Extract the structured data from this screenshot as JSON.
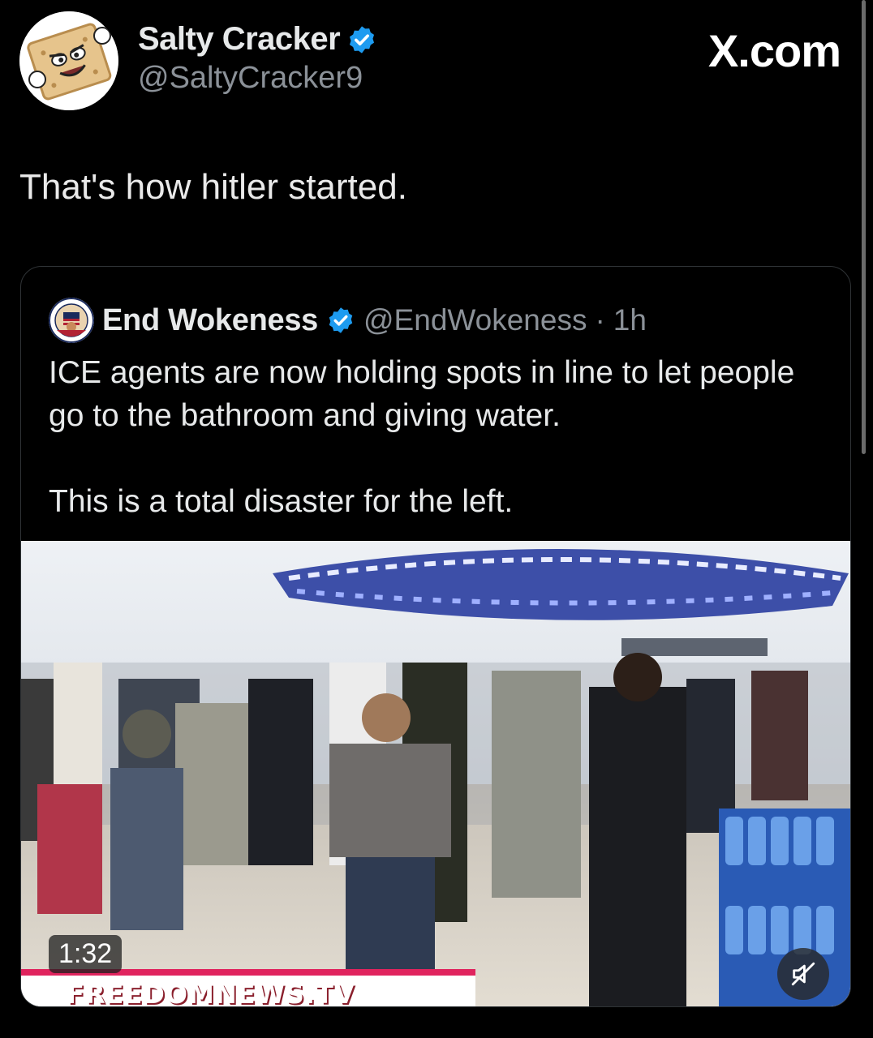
{
  "post": {
    "author_name": "Salty Cracker",
    "author_handle": "@SaltyCracker9",
    "site_mark": "X.com",
    "text": "That's how hitler started.",
    "avatar_icon": "salty-cracker-cartoon-avatar",
    "verified_icon": "verified-badge-icon",
    "accent_color": "#1d9bf0"
  },
  "quote": {
    "author_name": "End Wokeness",
    "author_handle": "@EndWokeness",
    "separator": "·",
    "time": "1h",
    "paragraphs": [
      "ICE agents are now holding spots in line to let people go to the bathroom and giving water.",
      "This is a total disaster for the left."
    ],
    "avatar_icon": "end-wokeness-seal-avatar",
    "verified_icon": "verified-badge-icon"
  },
  "video": {
    "duration": "1:32",
    "watermark": "FREEDOMNEWS.TV",
    "mute_icon": "muted-speaker-icon",
    "scene_description_icon": "airport-queue-video-thumbnail"
  }
}
